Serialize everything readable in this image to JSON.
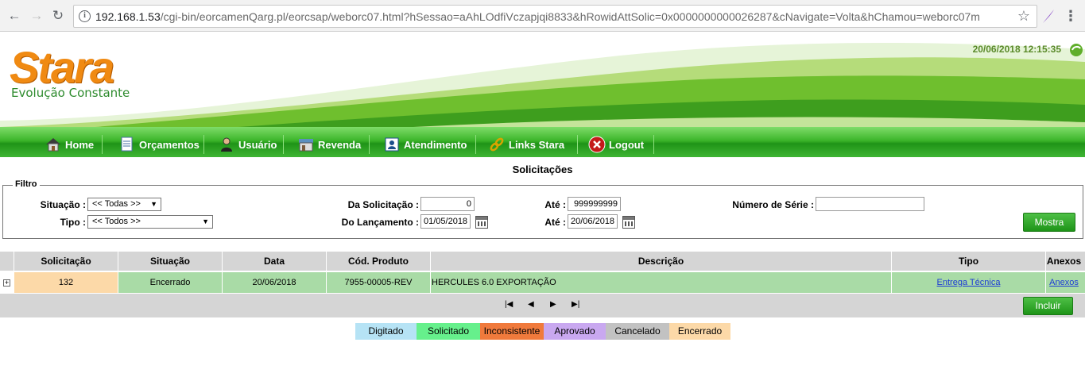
{
  "browser": {
    "url_host": "192.168.1.53",
    "url_path": "/cgi-bin/eorcamenQarg.pl/eorcsap/weborc07.html?hSessao=aAhLOdfiVczapjqi8833&hRowidAttSolic=0x0000000000026287&cNavigate=Volta&hChamou=weborc07m"
  },
  "header": {
    "logo": "Stara",
    "tagline": "Evolução Constante",
    "datetime": "20/06/2018 12:15:35"
  },
  "menu": {
    "home": "Home",
    "orcamentos": "Orçamentos",
    "usuario": "Usuário",
    "revenda": "Revenda",
    "atendimento": "Atendimento",
    "links": "Links Stara",
    "logout": "Logout"
  },
  "page_title": "Solicitações",
  "filter": {
    "legend": "Filtro",
    "situacao_label": "Situação :",
    "situacao_value": "<< Todas >>",
    "tipo_label": "Tipo :",
    "tipo_value": "<< Todos >>",
    "da_solicitacao_label": "Da Solicitação :",
    "da_solicitacao_value": "0",
    "ate1_label": "Até :",
    "ate1_value": "999999999",
    "do_lancamento_label": "Do Lançamento :",
    "do_lancamento_value": "01/05/2018",
    "ate2_label": "Até :",
    "ate2_value": "20/06/2018",
    "numero_serie_label": "Número de Série :",
    "numero_serie_value": "",
    "mostra_button": "Mostra"
  },
  "table": {
    "headers": [
      "Solicitação",
      "Situação",
      "Data",
      "Cód. Produto",
      "Descrição",
      "Tipo",
      "Anexos"
    ],
    "rows": [
      {
        "solicitacao": "132",
        "situacao": "Encerrado",
        "data": "20/06/2018",
        "cod_produto": "7955-00005-REV",
        "descricao": "HERCULES 6.0 EXPORTAÇÃO",
        "tipo": "Entrega Técnica",
        "anexos": "Anexos"
      }
    ]
  },
  "pager": {
    "first": "|◀",
    "prev": "◀",
    "next": "▶",
    "last": "▶|"
  },
  "incluir_button": "Incluir",
  "legend": [
    {
      "label": "Digitado",
      "color": "#b6e3f5"
    },
    {
      "label": "Solicitado",
      "color": "#66f08c"
    },
    {
      "label": "Inconsistente",
      "color": "#f07a3c"
    },
    {
      "label": "Aprovado",
      "color": "#c9a8f0"
    },
    {
      "label": "Cancelado",
      "color": "#c2c2c2"
    },
    {
      "label": "Encerrado",
      "color": "#fcd9a8"
    }
  ],
  "colors": {
    "menu_green": "#1f9417",
    "row_green": "#a9dba6",
    "encerrado": "#fcd9a8",
    "logo_orange": "#f08a12"
  }
}
